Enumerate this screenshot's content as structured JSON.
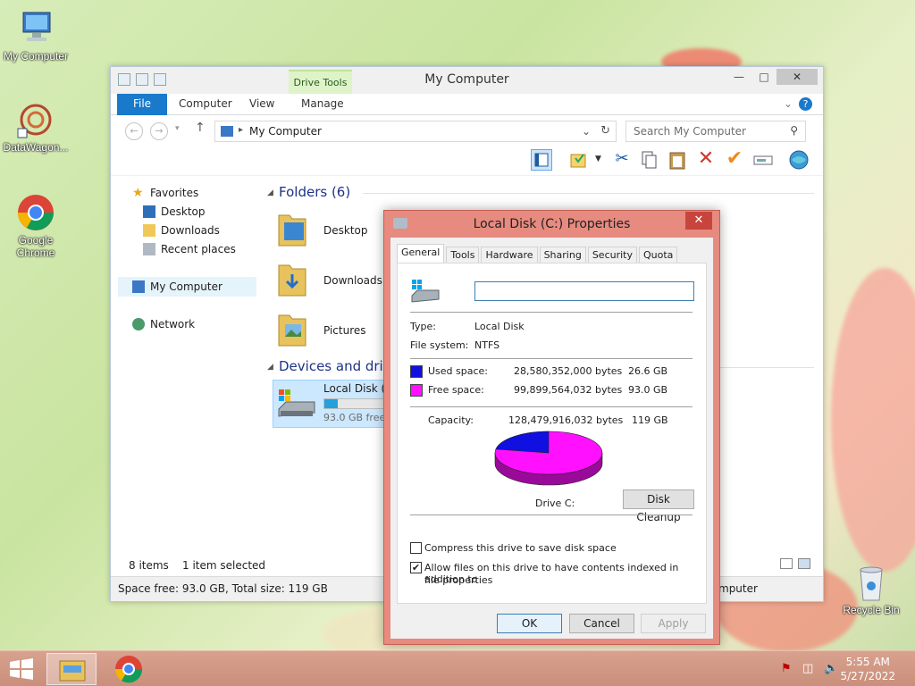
{
  "desktop": {
    "icons": [
      {
        "label": "My Computer"
      },
      {
        "label": "DataWagon..."
      },
      {
        "label": "Google Chrome"
      },
      {
        "label": "Recycle Bin"
      }
    ]
  },
  "explorer": {
    "title": "My Computer",
    "contextual_tab": "Drive Tools",
    "ribbon_tabs": {
      "file": "File",
      "computer": "Computer",
      "view": "View",
      "manage": "Manage"
    },
    "address": "My Computer",
    "search_placeholder": "Search My Computer",
    "nav": {
      "favorites": "Favorites",
      "desktop": "Desktop",
      "downloads": "Downloads",
      "recent": "Recent places",
      "mycomputer": "My Computer",
      "network": "Network"
    },
    "folders_header": "Folders (6)",
    "folders": [
      "Desktop",
      "Downloads",
      "Pictures"
    ],
    "devices_header": "Devices and drive",
    "drive": {
      "name": "Local Disk (C",
      "free_text": "93.0 GB free o",
      "used_fraction": 0.22
    },
    "status": {
      "items": "8 items",
      "selected": "1 item selected"
    },
    "details_bar": {
      "space": "Space free: 93.0 GB, Total size: 119 GB",
      "right": "mputer"
    }
  },
  "dialog": {
    "title": "Local Disk (C:) Properties",
    "tabs": [
      "General",
      "Tools",
      "Hardware",
      "Sharing",
      "Security",
      "Quota"
    ],
    "name_value": "",
    "type_label": "Type:",
    "type_value": "Local Disk",
    "fs_label": "File system:",
    "fs_value": "NTFS",
    "used_label": "Used space:",
    "used_bytes": "28,580,352,000 bytes",
    "used_gb": "26.6 GB",
    "free_label": "Free space:",
    "free_bytes": "99,899,564,032 bytes",
    "free_gb": "93.0 GB",
    "cap_label": "Capacity:",
    "cap_bytes": "128,479,916,032 bytes",
    "cap_gb": "119 GB",
    "drive_label": "Drive C:",
    "cleanup": "Disk Cleanup",
    "compress": "Compress this drive to save disk space",
    "compress_checked": false,
    "index_text_1": "Allow files on this drive to have contents indexed in addition to",
    "index_text_2": "file properties",
    "index_checked": true,
    "ok": "OK",
    "cancel": "Cancel",
    "apply": "Apply",
    "colors": {
      "used": "#1010e0",
      "free": "#ff10ff"
    },
    "used_fraction": 0.2225
  },
  "taskbar": {
    "time": "5:55 AM",
    "date": "5/27/2022"
  }
}
